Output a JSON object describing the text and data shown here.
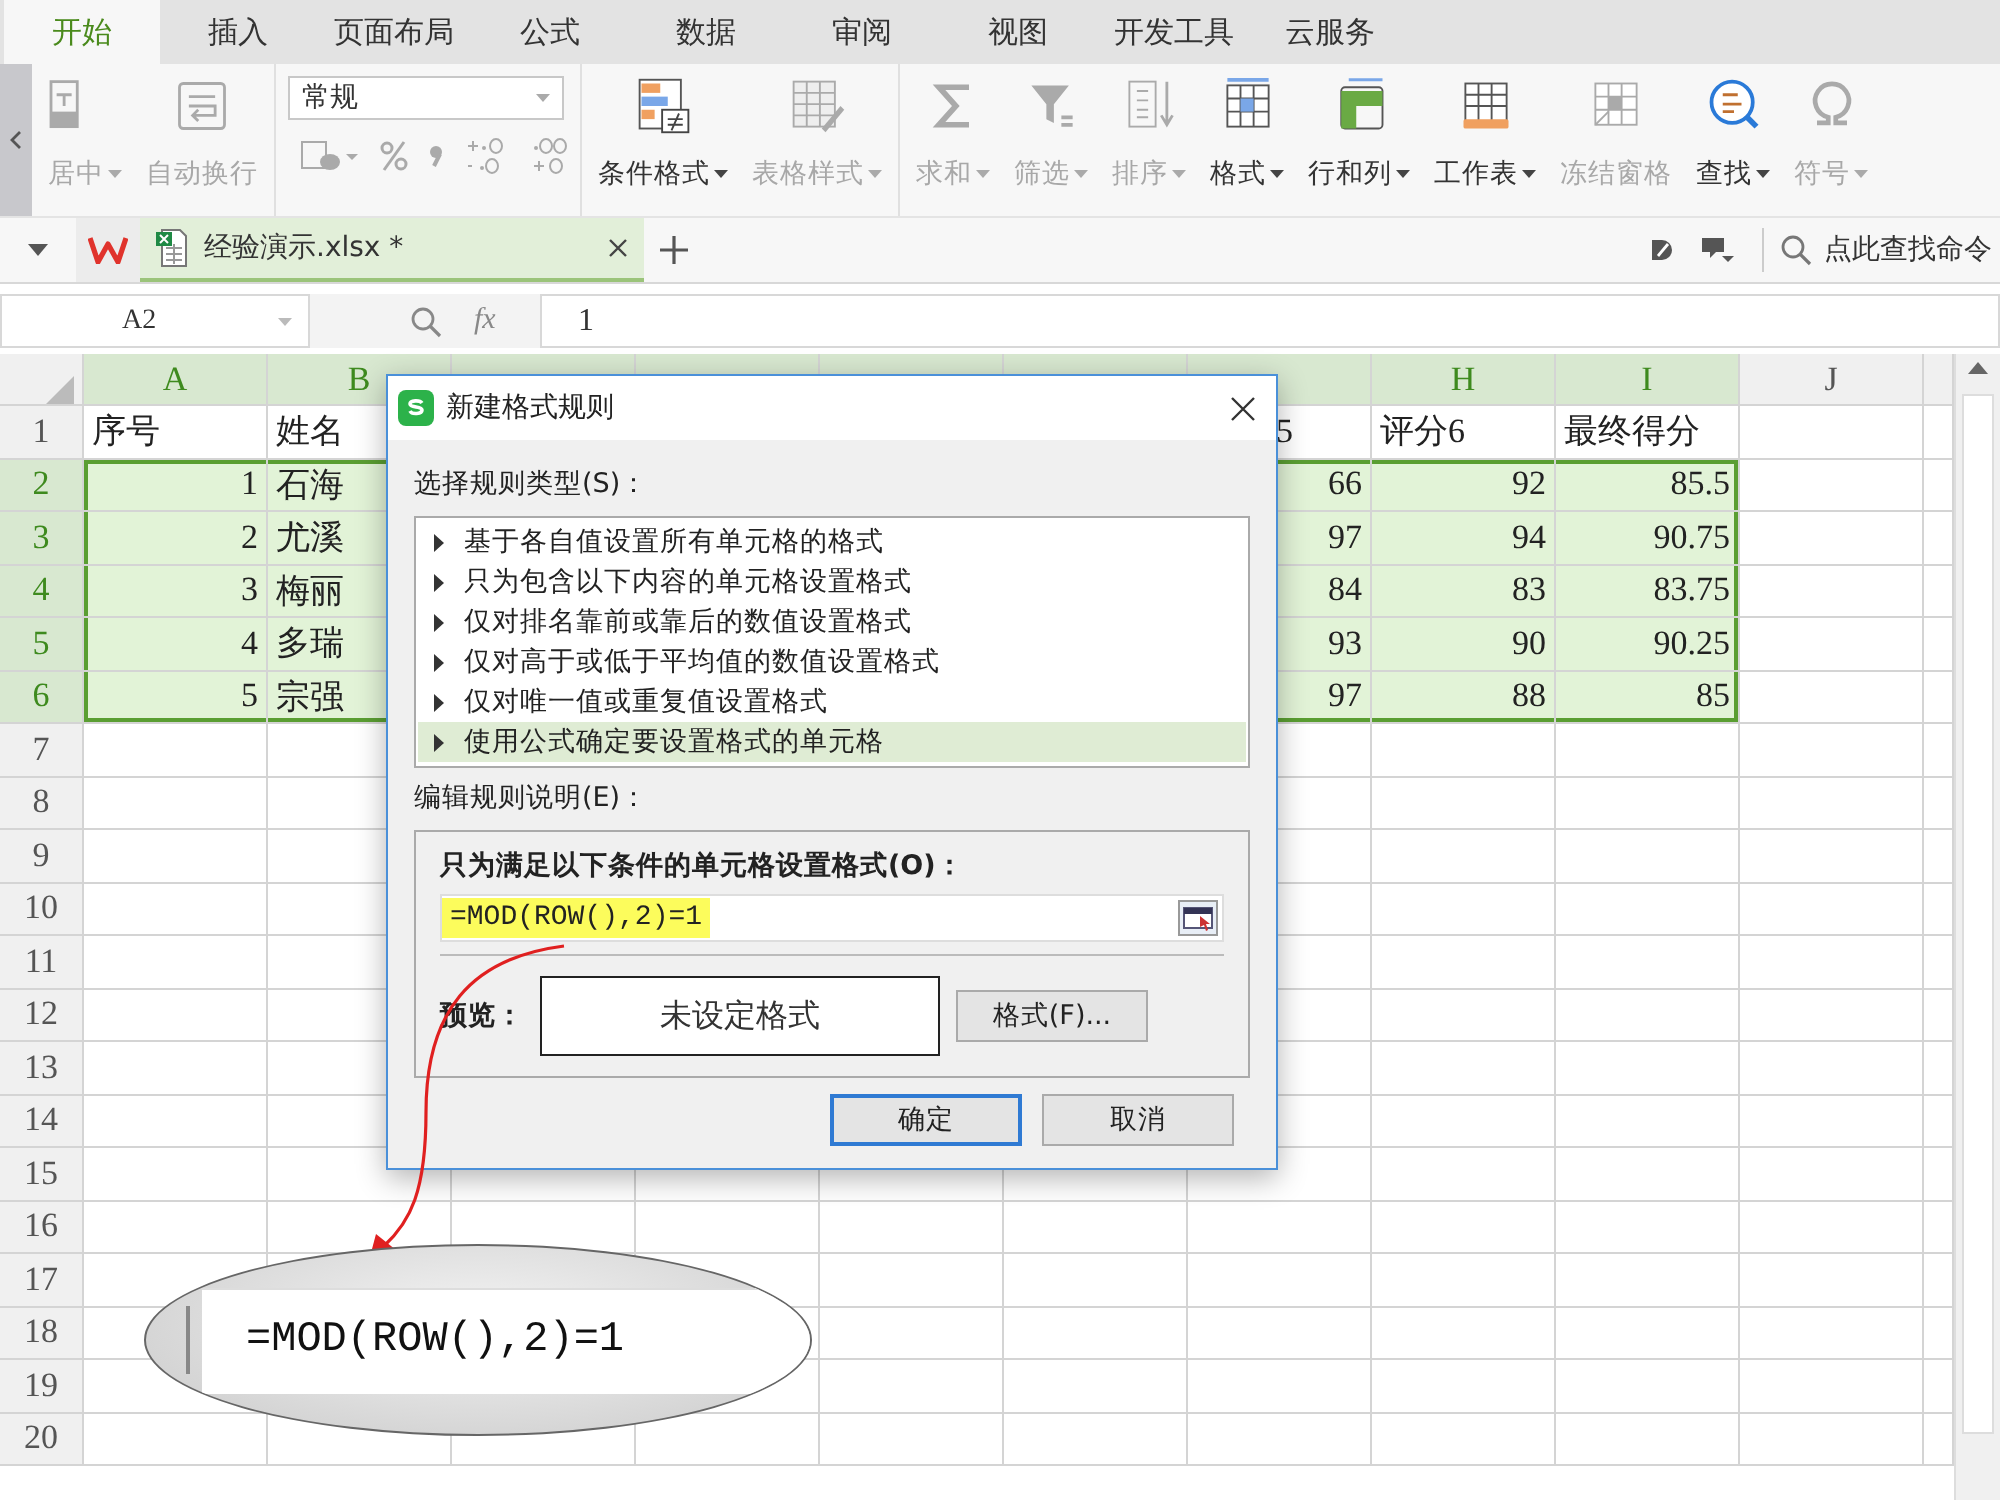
{
  "menu_tabs": [
    {
      "label": "开始",
      "selected": true
    },
    {
      "label": "插入",
      "selected": false
    },
    {
      "label": "页面布局",
      "selected": false
    },
    {
      "label": "公式",
      "selected": false
    },
    {
      "label": "数据",
      "selected": false
    },
    {
      "label": "审阅",
      "selected": false
    },
    {
      "label": "视图",
      "selected": false
    },
    {
      "label": "开发工具",
      "selected": false
    },
    {
      "label": "云服务",
      "selected": false
    }
  ],
  "ribbon": {
    "groups": [
      {
        "items": [
          {
            "kind": "big",
            "label": "居中",
            "dropdown": true,
            "disabled": true
          },
          {
            "kind": "big",
            "label": "自动换行",
            "dropdown": false,
            "disabled": true
          }
        ]
      },
      {
        "items": [
          {
            "kind": "number",
            "label": "常规",
            "dropdown": true,
            "disabled": true
          }
        ]
      },
      {
        "items": [
          {
            "kind": "big",
            "label": "条件格式",
            "dropdown": true,
            "disabled": false
          },
          {
            "kind": "big",
            "label": "表格样式",
            "dropdown": true,
            "disabled": true
          }
        ]
      },
      {
        "items": [
          {
            "kind": "big",
            "label": "求和",
            "dropdown": true,
            "disabled": true
          },
          {
            "kind": "big",
            "label": "筛选",
            "dropdown": true,
            "disabled": true
          },
          {
            "kind": "big",
            "label": "排序",
            "dropdown": true,
            "disabled": true
          },
          {
            "kind": "big",
            "label": "格式",
            "dropdown": true,
            "disabled": false
          },
          {
            "kind": "big",
            "label": "行和列",
            "dropdown": true,
            "disabled": false
          },
          {
            "kind": "big",
            "label": "工作表",
            "dropdown": true,
            "disabled": false
          },
          {
            "kind": "big",
            "label": "冻结窗格",
            "dropdown": false,
            "disabled": true
          },
          {
            "kind": "big",
            "label": "查找",
            "dropdown": true,
            "disabled": false
          },
          {
            "kind": "big",
            "label": "符号",
            "dropdown": true,
            "disabled": true
          }
        ]
      }
    ]
  },
  "document_tabs": [
    {
      "title": "经验演示.xlsx *",
      "selected": true
    }
  ],
  "command_search": {
    "placeholder": "点此查找命令"
  },
  "formula_bar": {
    "name_box": "A2",
    "function_label": "fx",
    "value": "1"
  },
  "sheet": {
    "columns": [
      {
        "label": "A",
        "selected": true
      },
      {
        "label": "B",
        "selected": true
      },
      {
        "selected": true
      },
      {
        "selected": true
      },
      {
        "selected": true
      },
      {
        "selected": true
      },
      {
        "selected": true
      },
      {
        "label": "H",
        "selected": true
      },
      {
        "label": "I",
        "selected": true
      },
      {
        "label": "J",
        "selected": false
      }
    ],
    "rows": [
      {
        "label": "1",
        "kind": "header",
        "selected": false,
        "cells": {
          "A": "序号",
          "B": "姓名",
          "G": "5",
          "H": "评分6",
          "I": "最终得分"
        }
      },
      {
        "label": "2",
        "kind": "data",
        "selected": true,
        "cells": {
          "A": "1",
          "B": "石海",
          "G": "66",
          "H": "92",
          "I": "85.5"
        }
      },
      {
        "label": "3",
        "kind": "data",
        "selected": true,
        "cells": {
          "A": "2",
          "B": "尤溪",
          "G": "97",
          "H": "94",
          "I": "90.75"
        }
      },
      {
        "label": "4",
        "kind": "data",
        "selected": true,
        "cells": {
          "A": "3",
          "B": "梅丽",
          "G": "84",
          "H": "83",
          "I": "83.75"
        }
      },
      {
        "label": "5",
        "kind": "data",
        "selected": true,
        "cells": {
          "A": "4",
          "B": "多瑞",
          "G": "93",
          "H": "90",
          "I": "90.25"
        }
      },
      {
        "label": "6",
        "kind": "data",
        "selected": true,
        "cells": {
          "A": "5",
          "B": "宗强",
          "G": "97",
          "H": "88",
          "I": "85"
        }
      },
      {
        "label": "7",
        "kind": "data",
        "selected": false
      },
      {
        "label": "8",
        "kind": "data",
        "selected": false
      },
      {
        "label": "9",
        "kind": "data",
        "selected": false
      },
      {
        "label": "10",
        "kind": "data",
        "selected": false
      },
      {
        "label": "11",
        "kind": "data",
        "selected": false
      },
      {
        "label": "12",
        "kind": "data",
        "selected": false
      },
      {
        "label": "13",
        "kind": "data",
        "selected": false
      },
      {
        "label": "14",
        "kind": "data",
        "selected": false
      },
      {
        "label": "15",
        "kind": "data",
        "selected": false
      },
      {
        "label": "16",
        "kind": "data",
        "selected": false
      },
      {
        "label": "17",
        "kind": "data",
        "selected": false
      },
      {
        "label": "18",
        "kind": "data",
        "selected": false
      },
      {
        "label": "19",
        "kind": "data",
        "selected": false
      },
      {
        "label": "20",
        "kind": "data",
        "selected": false
      }
    ]
  },
  "dialog": {
    "title": "新建格式规则",
    "rule_type_label": "选择规则类型(S)：",
    "rule_types": [
      {
        "label": "基于各自值设置所有单元格的格式",
        "selected": false
      },
      {
        "label": "只为包含以下内容的单元格设置格式",
        "selected": false
      },
      {
        "label": "仅对排名靠前或靠后的数值设置格式",
        "selected": false
      },
      {
        "label": "仅对高于或低于平均值的数值设置格式",
        "selected": false
      },
      {
        "label": "仅对唯一值或重复值设置格式",
        "selected": false
      },
      {
        "label": "使用公式确定要设置格式的单元格",
        "selected": true
      }
    ],
    "description_label": "编辑规则说明(E)：",
    "condition_label": "只为满足以下条件的单元格设置格式(O)：",
    "formula": "=MOD(ROW(),2)=1",
    "formula_highlighted": true,
    "preview_label": "预览：",
    "preview_text": "未设定格式",
    "format_button": "格式(F)...",
    "buttons": [
      {
        "label": "确定",
        "default": true
      },
      {
        "label": "取消",
        "default": false
      }
    ]
  },
  "annotation": {
    "formula": "=MOD(ROW(),2)=1"
  }
}
